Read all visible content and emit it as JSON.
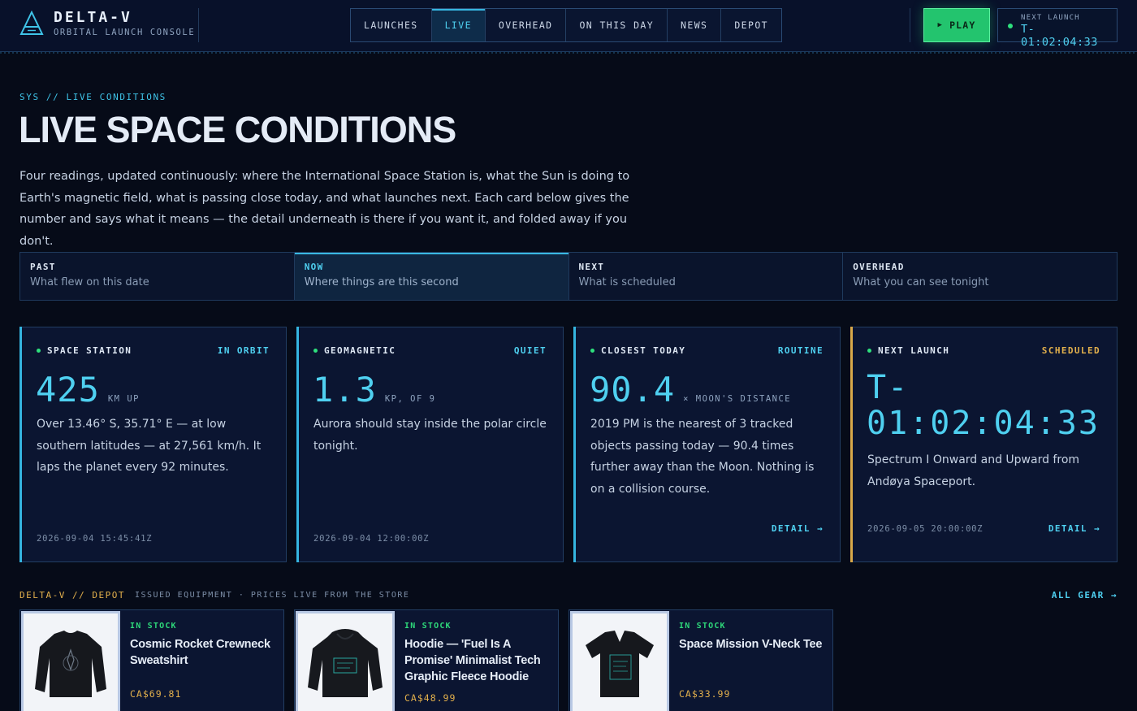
{
  "header": {
    "brand_name": "DELTA-V",
    "brand_sub": "ORBITAL LAUNCH CONSOLE",
    "nav": [
      "LAUNCHES",
      "LIVE",
      "OVERHEAD",
      "ON THIS DAY",
      "NEWS",
      "DEPOT"
    ],
    "active_nav": "LIVE",
    "play_label": "PLAY",
    "next_launch_label": "NEXT LAUNCH",
    "next_launch_value": "T-01:02:04:33"
  },
  "hero": {
    "eyebrow": "SYS // LIVE CONDITIONS",
    "title": "LIVE SPACE CONDITIONS",
    "intro": "Four readings, updated continuously: where the International Space Station is, what the Sun is doing to Earth's magnetic field, what is passing close today, and what launches next. Each card below gives the number and says what it means — the detail underneath is there if you want it, and folded away if you don't."
  },
  "tabs": [
    {
      "label": "PAST",
      "sub": "What flew on this date"
    },
    {
      "label": "NOW",
      "sub": "Where things are this second"
    },
    {
      "label": "NEXT",
      "sub": "What is scheduled"
    },
    {
      "label": "OVERHEAD",
      "sub": "What you can see tonight"
    }
  ],
  "cards": {
    "station": {
      "label": "SPACE STATION",
      "status": "IN ORBIT",
      "value": "425",
      "unit": "KM UP",
      "desc": "Over 13.46° S, 35.71° E — at low southern latitudes — at 27,561 km/h. It laps the planet every 92 minutes.",
      "stamp": "2026-09-04 15:45:41Z"
    },
    "geomagnetic": {
      "label": "GEOMAGNETIC",
      "status": "QUIET",
      "value": "1.3",
      "unit": "KP, OF 9",
      "desc": "Aurora should stay inside the polar circle tonight.",
      "stamp": "2026-09-04 12:00:00Z"
    },
    "closest": {
      "label": "CLOSEST TODAY",
      "status": "ROUTINE",
      "value": "90.4",
      "unit": "× MOON'S DISTANCE",
      "desc": "2019 PM is the nearest of 3 tracked objects passing today — 90.4 times further away than the Moon. Nothing is on a collision course.",
      "detail": "DETAIL →"
    },
    "launch": {
      "label": "NEXT LAUNCH",
      "status": "SCHEDULED",
      "value": "T-01:02:04:33",
      "desc": "Spectrum I Onward and Upward from Andøya Spaceport.",
      "stamp": "2026-09-05 20:00:00Z",
      "detail": "DETAIL →"
    }
  },
  "depot": {
    "title": "DELTA-V // DEPOT",
    "subtitle": "ISSUED EQUIPMENT · PRICES LIVE FROM THE STORE",
    "all_link": "ALL GEAR →",
    "products": [
      {
        "stock": "IN STOCK",
        "name": "Cosmic Rocket Crewneck Sweatshirt",
        "price": "CA$69.81"
      },
      {
        "stock": "IN STOCK",
        "name": "Hoodie — 'Fuel Is A Promise' Minimalist Tech Graphic Fleece Hoodie",
        "price": "CA$48.99"
      },
      {
        "stock": "IN STOCK",
        "name": "Space Mission V-Neck Tee",
        "price": "CA$33.99"
      }
    ]
  },
  "colors": {
    "accent": "#4fd0f0",
    "go_green": "#23c46e",
    "gold": "#e2b04c",
    "background": "#060b18"
  },
  "icons": [
    "delta-logo-icon",
    "play-icon",
    "status-dot-icon"
  ]
}
